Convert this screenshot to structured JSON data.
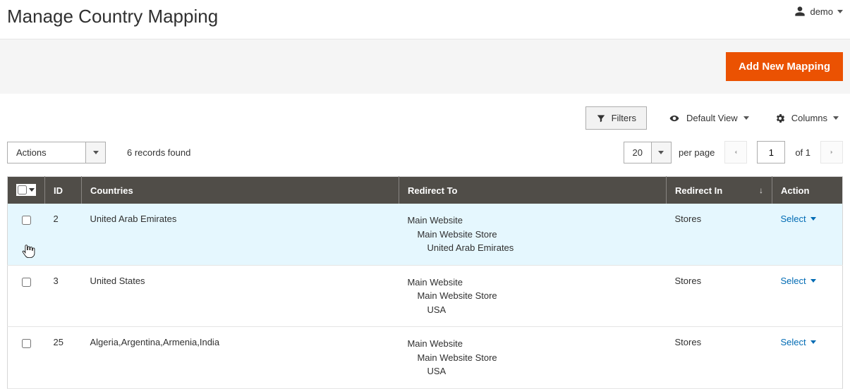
{
  "header": {
    "title": "Manage Country Mapping",
    "user_label": "demo"
  },
  "buttons": {
    "add_new": "Add New Mapping",
    "filters": "Filters",
    "default_view": "Default View",
    "columns": "Columns"
  },
  "actions": {
    "label": "Actions"
  },
  "records": {
    "found_text": "6 records found"
  },
  "pager": {
    "page_size": "20",
    "per_page_label": "per page",
    "current_page": "1",
    "of_label": "of 1"
  },
  "columns": {
    "id": "ID",
    "countries": "Countries",
    "redirect_to": "Redirect To",
    "redirect_in": "Redirect In",
    "action": "Action"
  },
  "row_action_label": "Select",
  "rows": [
    {
      "id": "2",
      "countries": "United Arab Emirates",
      "redirect_to": {
        "l1": "Main Website",
        "l2": "Main Website Store",
        "l3": "United Arab Emirates"
      },
      "redirect_in": "Stores"
    },
    {
      "id": "3",
      "countries": "United States",
      "redirect_to": {
        "l1": "Main Website",
        "l2": "Main Website Store",
        "l3": "USA"
      },
      "redirect_in": "Stores"
    },
    {
      "id": "25",
      "countries": "Algeria,Argentina,Armenia,India",
      "redirect_to": {
        "l1": "Main Website",
        "l2": "Main Website Store",
        "l3": "USA"
      },
      "redirect_in": "Stores"
    }
  ]
}
